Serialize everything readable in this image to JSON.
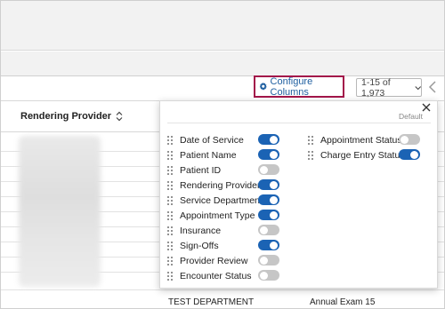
{
  "toolbar": {
    "configure_label": "Configure Columns",
    "pager_text": "1-15 of 1,973"
  },
  "grid": {
    "header_label": "Rendering Provider",
    "bottom_row": {
      "department": "TEST DEPARTMENT",
      "appointment": "Annual Exam 15"
    }
  },
  "panel": {
    "default_label": "Default",
    "left_column": [
      {
        "label": "Date of Service",
        "on": true
      },
      {
        "label": "Patient Name",
        "on": true
      },
      {
        "label": "Patient ID",
        "on": false
      },
      {
        "label": "Rendering Provider",
        "on": true
      },
      {
        "label": "Service Department",
        "on": true
      },
      {
        "label": "Appointment Type",
        "on": true
      },
      {
        "label": "Insurance",
        "on": false
      },
      {
        "label": "Sign-Offs",
        "on": true
      },
      {
        "label": "Provider Review",
        "on": false
      },
      {
        "label": "Encounter Status",
        "on": false
      }
    ],
    "right_column": [
      {
        "label": "Appointment Status",
        "on": false
      },
      {
        "label": "Charge Entry Status",
        "on": true
      }
    ]
  },
  "colors": {
    "accent_blue": "#1b63b4",
    "link_blue": "#1f5fa0",
    "highlight_border": "#a3154a",
    "toggle_off": "#c6c6c6"
  },
  "icons": [
    "gear-icon",
    "chevron-down-icon",
    "chevron-left-icon",
    "sort-icon",
    "close-icon",
    "drag-handle-icon"
  ]
}
